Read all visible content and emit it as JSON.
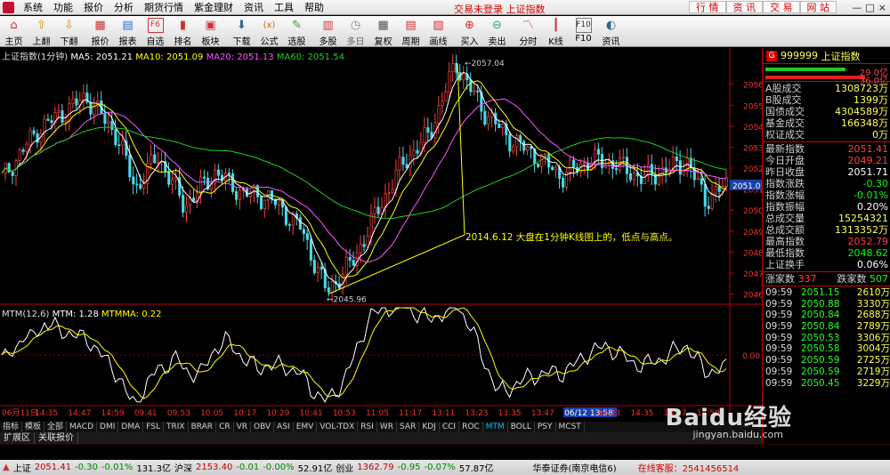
{
  "menubar": {
    "items": [
      "系统",
      "功能",
      "报价",
      "分析",
      "期货行情",
      "紫金理财",
      "资讯",
      "工具",
      "帮助"
    ],
    "center_text": "交易未登录  上证指数",
    "right_buttons": [
      "行 情",
      "资 讯",
      "交 易",
      "网 站"
    ],
    "window_controls": [
      "—",
      "□",
      "×"
    ]
  },
  "toolbar": {
    "items": [
      {
        "label": "主页",
        "icon": "home-icon"
      },
      {
        "label": "上翻",
        "icon": "up-arrow-icon"
      },
      {
        "label": "下翻",
        "icon": "down-arrow-icon"
      },
      {
        "label": "报价",
        "icon": "quote-icon"
      },
      {
        "label": "报表",
        "icon": "report-icon"
      },
      {
        "label": "自选",
        "icon": "f6-icon"
      },
      {
        "label": "排名",
        "icon": "rank-icon"
      },
      {
        "label": "板块",
        "icon": "sector-icon"
      },
      {
        "label": "下载",
        "icon": "download-icon"
      },
      {
        "label": "公式",
        "icon": "formula-icon"
      },
      {
        "label": "选股",
        "icon": "pick-stock-icon"
      },
      {
        "label": "多股",
        "icon": "multi-stock-icon"
      },
      {
        "label": "多日",
        "icon": "multi-day-icon"
      },
      {
        "label": "复权",
        "icon": "restore-icon"
      },
      {
        "label": "周期",
        "icon": "period-icon"
      },
      {
        "label": "画线",
        "icon": "draw-line-icon"
      },
      {
        "label": "买入",
        "icon": "buy-icon"
      },
      {
        "label": "卖出",
        "icon": "sell-icon"
      },
      {
        "label": "分时",
        "icon": "timeshare-icon"
      },
      {
        "label": "K线",
        "icon": "kline-icon"
      },
      {
        "label": "F10",
        "icon": "f10-icon"
      },
      {
        "label": "资讯",
        "icon": "info-icon"
      }
    ]
  },
  "main_chart": {
    "legend": {
      "name": "上证指数(1分钟)",
      "ma5": "MA5: 2051.21",
      "ma10": "MA10: 2051.09",
      "ma20": "MA20: 2051.13",
      "ma60": "MA60: 2051.54"
    },
    "annotations": {
      "high": "2057.04",
      "low": "2045.96",
      "comment": "2014.6.12 大盘在1分钟K线图上的，低点与高点。"
    },
    "price_tag": "2051.0",
    "y_ticks": [
      "2056",
      "2055",
      "2054",
      "2053",
      "2052",
      "2051",
      "2050",
      "2049",
      "2048",
      "2047",
      "2046"
    ],
    "colors": {
      "up": "#ff4040",
      "down": "#4dd9e8",
      "ma5": "#ffffff",
      "ma10": "#ffff00",
      "ma20": "#ff55ff",
      "ma60": "#22cc22"
    }
  },
  "sub_chart": {
    "legend": {
      "name": "MTM(12,6)",
      "mtm": "MTM: 1.28",
      "mtmma": "MTMMA: 0.22"
    },
    "zero_label": "0.00"
  },
  "time_axis": [
    "06月11日",
    "14:35",
    "14:47",
    "14:59",
    "09:41",
    "09:53",
    "10:05",
    "10:17",
    "10:29",
    "10:41",
    "10:53",
    "11:05",
    "11:17",
    "13:11",
    "13:23",
    "13:35",
    "13:47",
    "06/12 13:58",
    "14:23",
    "14:35",
    "14:47",
    "14:59"
  ],
  "indicator_tabs": [
    "指标",
    "模板",
    "全部",
    "MACD",
    "DMI",
    "DMA",
    "FSL",
    "TRIX",
    "BRAR",
    "CR",
    "VR",
    "OBV",
    "ASI",
    "EMV",
    "VOL-TDX",
    "RSI",
    "WR",
    "SAR",
    "KDJ",
    "CCI",
    "ROC",
    "MTM",
    "BOLL",
    "PSY",
    "MCST"
  ],
  "indicator_active": "MTM",
  "lower_tabs": [
    "扩展区",
    "关联报价"
  ],
  "panel": {
    "code": "999999",
    "name": "上证指数",
    "bar_top": "29.0亿",
    "bar_bottom": "36.0亿",
    "group1": [
      {
        "k": "A股成交",
        "v": "1308723万"
      },
      {
        "k": "B股成交",
        "v": "1399万"
      },
      {
        "k": "国债成交",
        "v": "4304589万"
      },
      {
        "k": "基金成交",
        "v": "166348万"
      },
      {
        "k": "权证成交",
        "v": "0万"
      }
    ],
    "group2": [
      {
        "k": "最新指数",
        "v": "2051.41",
        "c": "#ff4040"
      },
      {
        "k": "今日开盘",
        "v": "2049.21",
        "c": "#ff4040"
      },
      {
        "k": "昨日收盘",
        "v": "2051.71",
        "c": "#ffffff"
      },
      {
        "k": "指数涨跌",
        "v": "-0.30",
        "c": "#00ff00"
      },
      {
        "k": "指数涨幅",
        "v": "-0.01%",
        "c": "#00ff00"
      },
      {
        "k": "指数振幅",
        "v": "0.20%",
        "c": "#ffffff"
      },
      {
        "k": "总成交量",
        "v": "15254321",
        "c": "#ffff54"
      },
      {
        "k": "总成交额",
        "v": "1313352万",
        "c": "#ffff54"
      },
      {
        "k": "最高指数",
        "v": "2052.79",
        "c": "#ff4040"
      },
      {
        "k": "最低指数",
        "v": "2048.62",
        "c": "#00ff00"
      },
      {
        "k": "上证换手",
        "v": "0.06%",
        "c": "#ffffff"
      }
    ],
    "updown": {
      "up_label": "涨家数",
      "up": "337",
      "down_label": "跌家数",
      "down": "507"
    },
    "ticks": [
      {
        "t": "09:59",
        "p": "2051.15",
        "v": "2610万"
      },
      {
        "t": "09:59",
        "p": "2050.88",
        "v": "3330万"
      },
      {
        "t": "09:59",
        "p": "2050.84",
        "v": "2688万"
      },
      {
        "t": "09:59",
        "p": "2050.84",
        "v": "2789万"
      },
      {
        "t": "09:59",
        "p": "2050.53",
        "v": "3306万"
      },
      {
        "t": "09:59",
        "p": "2050.58",
        "v": "3004万"
      },
      {
        "t": "09:59",
        "p": "2050.59",
        "v": "2725万"
      },
      {
        "t": "09:59",
        "p": "2050.59",
        "v": "2719万"
      },
      {
        "t": "09:59",
        "p": "2050.45",
        "v": "3229万"
      }
    ],
    "side_tabs": [
      "笔",
      "价",
      "细",
      "势",
      "指",
      "联",
      "值",
      "主"
    ]
  },
  "status": {
    "sh": {
      "name": "上证",
      "price": "2051.41",
      "chg": "-0.30",
      "pct": "-0.01%",
      "amt": "131.3亿"
    },
    "hs": {
      "name": "沪深",
      "price": "2153.40",
      "chg": "-0.01",
      "pct": "-0.00%",
      "amt": "52.91亿"
    },
    "cy": {
      "name": "创业",
      "price": "1362.79",
      "chg": "-0.95",
      "pct": "-0.07%",
      "amt": "57.87亿"
    },
    "broker": "华泰证券(南京电信6)",
    "online": "在线客服：2541456514"
  },
  "watermark": {
    "brand": "Baidu经验",
    "url": "jingyan.baidu.com"
  }
}
